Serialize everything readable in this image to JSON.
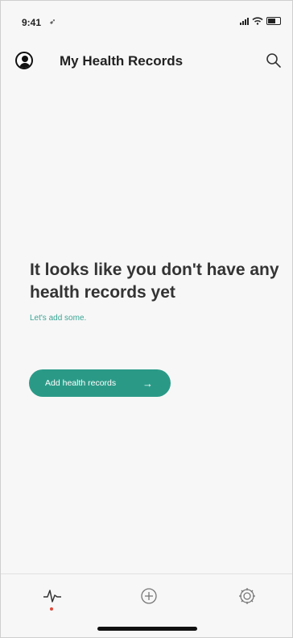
{
  "status_bar": {
    "time": "9:41",
    "location_icon": "location-arrow-icon",
    "signal_icon": "cellular-signal-icon",
    "wifi_icon": "wifi-icon",
    "battery_icon": "battery-icon"
  },
  "header": {
    "title": "My Health Records",
    "profile_icon": "user-profile-icon",
    "search_icon": "search-icon"
  },
  "empty_state": {
    "heading": "It looks like you don't have any health records yet",
    "subtext": "Let's add some.",
    "button_label": "Add health records",
    "button_icon": "arrow-right-icon"
  },
  "tab_bar": {
    "tabs": [
      {
        "name": "activity",
        "icon": "heartbeat-icon",
        "active": true
      },
      {
        "name": "add",
        "icon": "plus-circle-icon",
        "active": false
      },
      {
        "name": "settings",
        "icon": "gear-icon",
        "active": false
      }
    ],
    "active_indicator_color": "#e04a3a"
  },
  "colors": {
    "accent": "#2a9a87",
    "subtext": "#3aa594",
    "text": "#333333",
    "background": "#f7f7f7"
  }
}
